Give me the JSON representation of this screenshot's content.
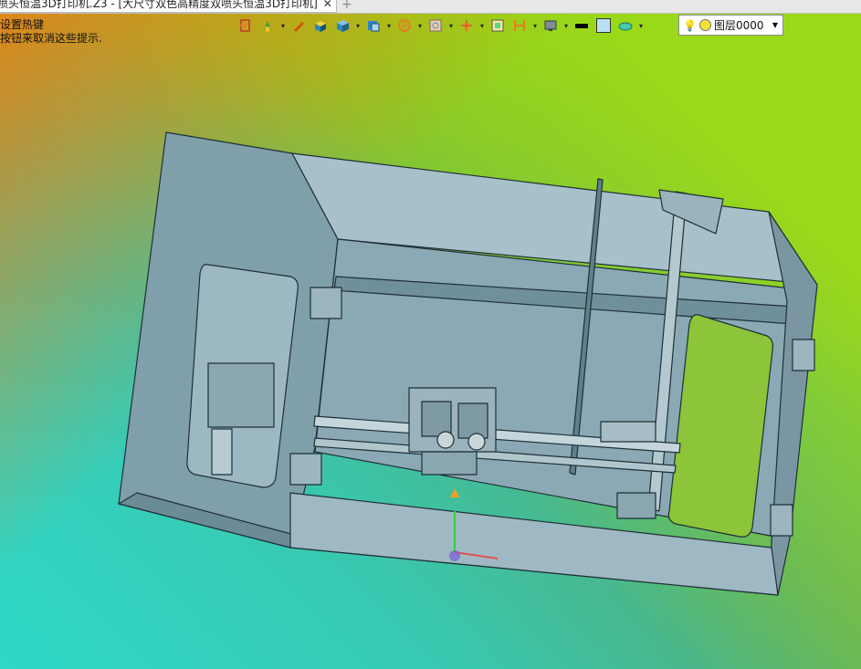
{
  "tab": {
    "title": "喷头恒温3D打印机.Z3 - [大尺寸双色高精度双喷头恒温3D打印机]",
    "close_glyph": "✕",
    "add_glyph": "+"
  },
  "hint": {
    "line1": "设置热键",
    "line2": "按钮来取消这些提示."
  },
  "toolbar": {
    "icons": [
      "exit-icon",
      "paint-icon",
      "pen-icon",
      "shaded-box-icon",
      "solid-box-icon",
      "view-cube-icon",
      "render-sphere-icon",
      "frame-icon",
      "axis-triad-icon",
      "grid-icon",
      "align-icon",
      "display-icon",
      "line-color",
      "face-color",
      "plane-icon"
    ],
    "line_color": "#000000",
    "face_color": "#b9e0f2"
  },
  "layer": {
    "value": "图层0000"
  },
  "colors": {
    "model_fill": "#8fb0bd",
    "model_dark": "#6f8f9c",
    "model_edge": "#1f2f36"
  }
}
